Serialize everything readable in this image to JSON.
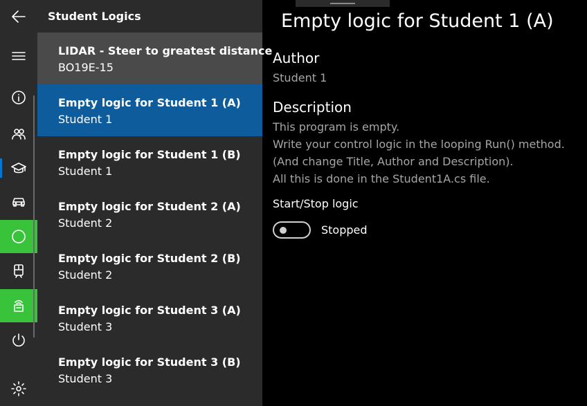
{
  "rail": {
    "icons": [
      "back-arrow-icon",
      "hamburger-menu-icon",
      "info-icon",
      "people-icon",
      "graduation-cap-icon",
      "car-icon",
      "circle-icon",
      "train-icon",
      "router-icon",
      "power-icon",
      "gear-icon"
    ]
  },
  "pane": {
    "title": "Student Logics",
    "items": [
      {
        "title": "LIDAR - Steer to greatest distance",
        "subtitle": "BO19E-15"
      },
      {
        "title": "Empty logic for Student 1 (A)",
        "subtitle": "Student 1"
      },
      {
        "title": "Empty logic for Student 1 (B)",
        "subtitle": "Student 1"
      },
      {
        "title": "Empty logic for Student 2 (A)",
        "subtitle": "Student 2"
      },
      {
        "title": "Empty logic for Student 2 (B)",
        "subtitle": "Student 2"
      },
      {
        "title": "Empty logic for Student 3 (A)",
        "subtitle": "Student 3"
      },
      {
        "title": "Empty logic for Student 3 (B)",
        "subtitle": "Student 3"
      }
    ]
  },
  "detail": {
    "title": "Empty logic for Student 1 (A)",
    "author_label": "Author",
    "author": "Student 1",
    "description_label": "Description",
    "description_lines": [
      "This program is empty.",
      "Write your control logic in the looping Run() method.",
      "(And change Title, Author and Description).",
      "All this is done in the Student1A.cs file."
    ],
    "toggle_label": "Start/Stop logic",
    "toggle_state": "Stopped"
  },
  "colors": {
    "selected": "#0f5c9c",
    "active_green": "#39c33a",
    "accent": "#0078d7"
  }
}
